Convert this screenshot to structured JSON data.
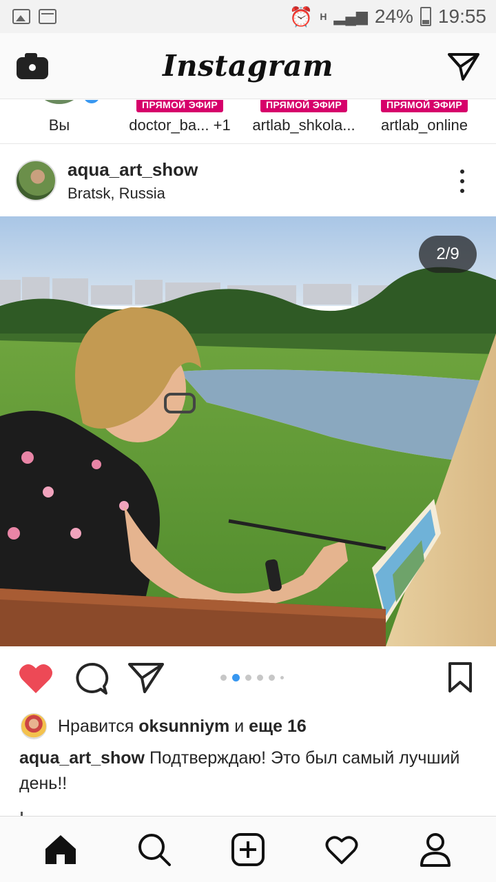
{
  "status_bar": {
    "battery": "24%",
    "time": "19:55",
    "network": "H"
  },
  "app": {
    "logo": "Instagram"
  },
  "stories": [
    {
      "name": "Вы",
      "live": ""
    },
    {
      "name": "doctor_ba... +1",
      "live": "ПРЯМОЙ ЭФИР"
    },
    {
      "name": "artlab_shkola...",
      "live": "ПРЯМОЙ ЭФИР"
    },
    {
      "name": "artlab_online",
      "live": "ПРЯМОЙ ЭФИР"
    }
  ],
  "post": {
    "username": "aqua_art_show",
    "location": "Bratsk, Russia",
    "counter": "2/9",
    "carousel": {
      "current": 2,
      "total": 9
    },
    "likes": {
      "prefix": "Нравится",
      "user": "oksunniym",
      "joiner": "и",
      "others": "еще 16"
    },
    "caption": {
      "user": "aqua_art_show",
      "text": "Подтверждаю! Это был самый лучший день!!"
    }
  },
  "icons": {
    "header_left": "camera-icon",
    "header_right": "direct-message-icon",
    "like": "heart-filled-icon",
    "comment": "comment-icon",
    "share": "share-icon",
    "save": "bookmark-icon",
    "nav": [
      "home-icon",
      "search-icon",
      "add-post-icon",
      "activity-heart-icon",
      "profile-icon"
    ]
  },
  "colors": {
    "like_red": "#ed4956",
    "active_dot": "#3897f0",
    "live_badge": "#d6006a"
  }
}
